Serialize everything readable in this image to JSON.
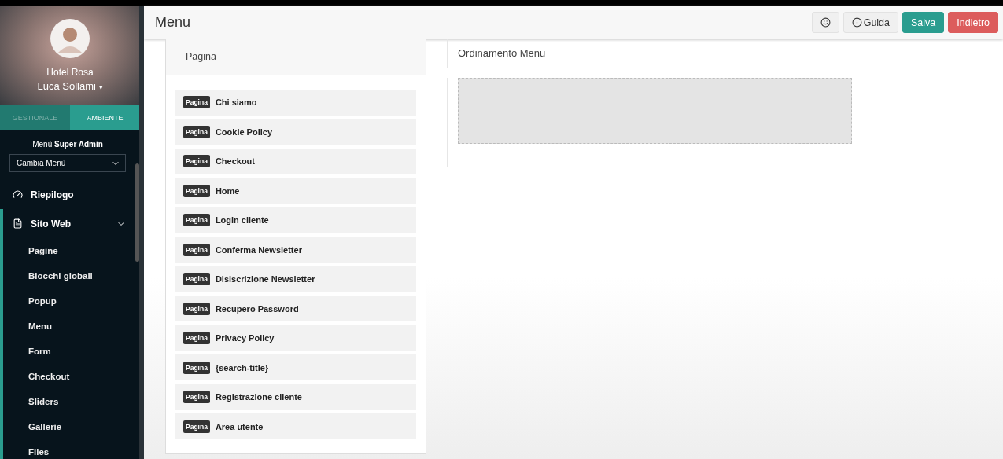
{
  "sidebar": {
    "profile": {
      "hotel": "Hotel Rosa",
      "user": "Luca Sollami",
      "caret": "▾"
    },
    "tabs": [
      {
        "label": "GESTIONALE",
        "selected": false
      },
      {
        "label": "AMBIENTE",
        "selected": true
      }
    ],
    "menu_label": "Menù **Super Admin**",
    "menu_select": {
      "value": "Cambia Menù"
    },
    "nav": [
      {
        "label": "Riepilogo",
        "selected": false
      },
      {
        "label": "Sito Web",
        "selected": true,
        "expanded": true,
        "children": [
          {
            "label": "Pagine"
          },
          {
            "label": "Blocchi globali"
          },
          {
            "label": "Popup"
          },
          {
            "label": "Menu"
          },
          {
            "label": "Form"
          },
          {
            "label": "Checkout"
          },
          {
            "label": "Sliders"
          },
          {
            "label": "Gallerie"
          },
          {
            "label": "Files"
          }
        ]
      }
    ]
  },
  "header": {
    "title": "Menu",
    "buttons": [
      {
        "kind": "icon"
      },
      {
        "kind": "info",
        "label": "Guida"
      },
      {
        "kind": "save",
        "label": "Salva"
      },
      {
        "kind": "back",
        "label": "Indietro"
      }
    ]
  },
  "pages_panel": {
    "title": "Pagina",
    "items": [
      {
        "tag": "Pagina",
        "label": "Chi siamo"
      },
      {
        "tag": "Pagina",
        "label": "Cookie Policy"
      },
      {
        "tag": "Pagina",
        "label": "Checkout"
      },
      {
        "tag": "Pagina",
        "label": "Home"
      },
      {
        "tag": "Pagina",
        "label": "Login cliente"
      },
      {
        "tag": "Pagina",
        "label": "Conferma Newsletter"
      },
      {
        "tag": "Pagina",
        "label": "Disiscrizione Newsletter"
      },
      {
        "tag": "Pagina",
        "label": "Recupero Password"
      },
      {
        "tag": "Pagina",
        "label": "Privacy Policy"
      },
      {
        "tag": "Pagina",
        "label": "{search-title}"
      },
      {
        "tag": "Pagina",
        "label": "Registrazione cliente"
      },
      {
        "tag": "Pagina",
        "label": "Area utente"
      }
    ]
  },
  "order_panel": {
    "title": "Ordinamento Menu"
  }
}
